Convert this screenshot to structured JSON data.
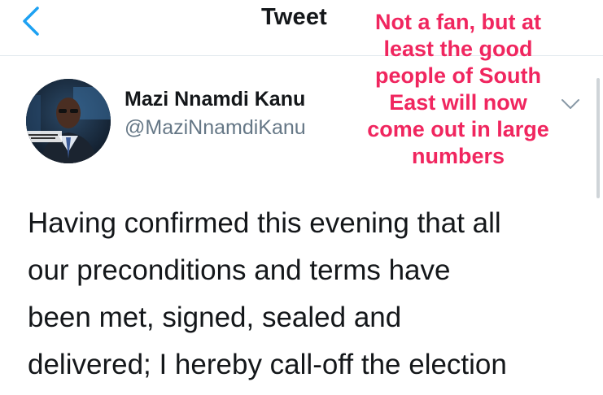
{
  "header": {
    "title": "Tweet",
    "back_icon": "chevron-left-icon",
    "accent_color": "#1da1f2"
  },
  "tweet": {
    "author_name": "Mazi Nnamdi Kanu",
    "author_handle": "@MaziNnamdiKanu",
    "menu_icon": "chevron-down-icon",
    "text": "Having confirmed this evening that all\nour preconditions and terms have\nbeen met, signed, sealed and\ndelivered; I hereby call-off the election"
  },
  "overlay": {
    "caption": "Not a fan, but at\nleast the good\npeople of South\nEast will now\ncome out in large\nnumbers",
    "color": "#f0265f"
  }
}
